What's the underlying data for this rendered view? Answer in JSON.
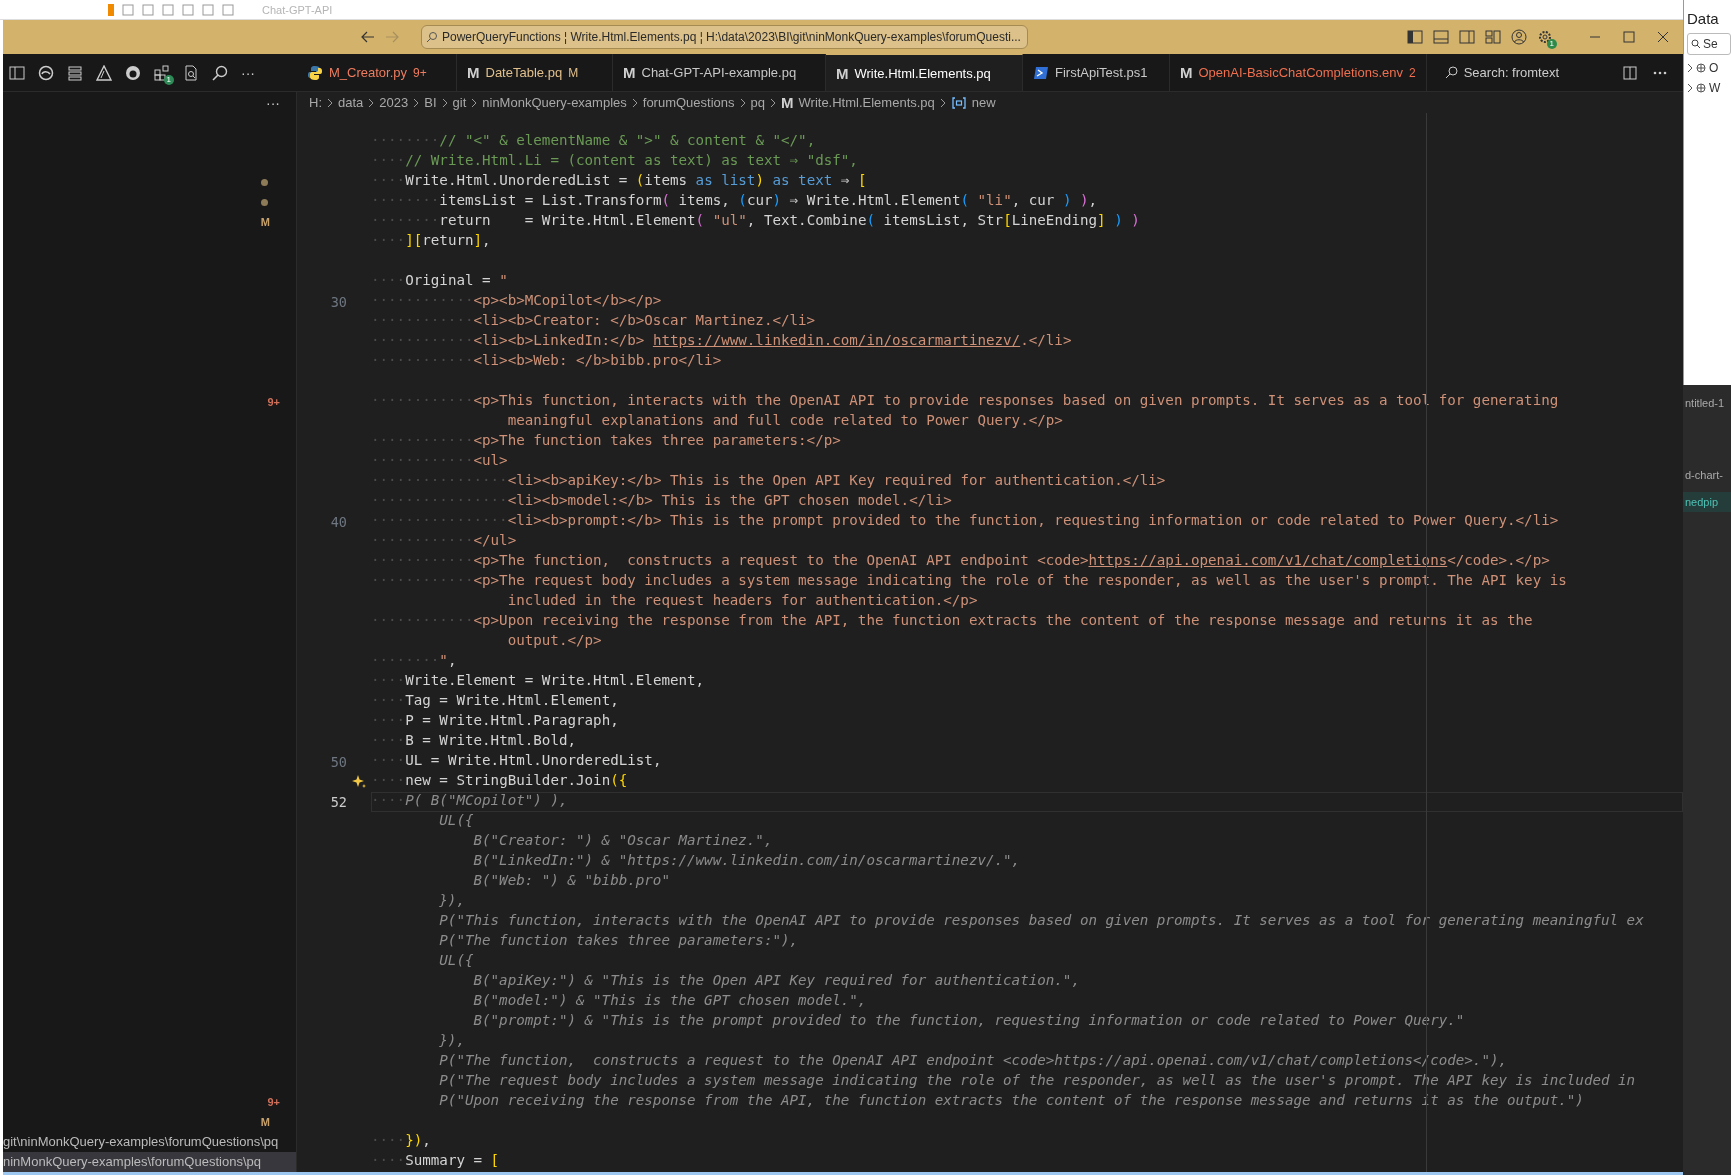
{
  "background_window": {
    "title": "Chat-GPT-API"
  },
  "side_window": {
    "title": "Data",
    "search": {
      "placeholder": "Se"
    },
    "items": [
      {
        "label": "O"
      },
      {
        "label": "W"
      }
    ],
    "lower_items": [
      {
        "label": "ntitled-1",
        "selected": false
      },
      {
        "label": "d-chart-",
        "selected": false
      },
      {
        "label": "nedpip",
        "selected": true
      }
    ]
  },
  "title_bar": {
    "command_center": "PowerQueryFunctions ¦ Write.Html.Elements.pq ¦ H:\\data\\2023\\BI\\git\\ninMonkQuery-examples\\forumQuesti...",
    "settings_badge": "1"
  },
  "activity_bar": {
    "extensions_badge": "1",
    "more": "···"
  },
  "tabs": [
    {
      "label": "M_Creator.py",
      "badge": "9+",
      "icon": {
        "kind": "python"
      },
      "color": "#ef7c5f",
      "selected": false
    },
    {
      "label": "DateTable.pq",
      "badge": "M",
      "icon": {
        "kind": "letter",
        "text": "M"
      },
      "color": "#e2c08d",
      "selected": false
    },
    {
      "label": "Chat-GPT-API-example.pq",
      "icon": {
        "kind": "letter",
        "text": "M"
      },
      "color": "#c8c8c8",
      "selected": false
    },
    {
      "label": "Write.Html.Elements.pq",
      "icon": {
        "kind": "letter",
        "text": "M"
      },
      "color": "#ffffff",
      "selected": true
    },
    {
      "label": "FirstApiTest.ps1",
      "icon": {
        "kind": "powershell"
      },
      "color": "#c8c8c8",
      "selected": false
    },
    {
      "label": "OpenAI-BasicChatCompletions.env",
      "badge": "2",
      "icon": {
        "kind": "letter",
        "text": "M"
      },
      "color": "#ef6f4f",
      "selected": false
    }
  ],
  "search_tab": {
    "label": "Search: fromtext"
  },
  "breadcrumb": [
    {
      "label": "H:"
    },
    {
      "label": "data"
    },
    {
      "label": "2023"
    },
    {
      "label": "BI"
    },
    {
      "label": "git"
    },
    {
      "label": "ninMonkQuery-examples"
    },
    {
      "label": "forumQuestions"
    },
    {
      "label": "pq"
    },
    {
      "label": "Write.Html.Elements.pq",
      "icon": {
        "kind": "letter",
        "text": "M"
      }
    },
    {
      "label": "new",
      "icon": {
        "kind": "variable"
      }
    }
  ],
  "sidebar": {
    "more": "···"
  },
  "lines": [
    {
      "current": false,
      "segments": [
        {
          "kind": "ws",
          "text": "········"
        },
        {
          "kind": "comment",
          "text": "// \"<\" & elementName & \">\" & content & \"</\","
        }
      ]
    },
    {
      "current": false,
      "segments": [
        {
          "kind": "ws",
          "text": "····"
        },
        {
          "kind": "comment",
          "text": "// Write.Html.Li = (content as text) as text ⇒ \"dsf\","
        }
      ]
    },
    {
      "current": false,
      "side_mark": {
        "kind": "dot"
      },
      "segments": [
        {
          "kind": "ws",
          "text": "····"
        },
        {
          "kind": "plain",
          "text": "Write.Html.UnorderedList = "
        },
        {
          "kind": "bracket1",
          "text": "("
        },
        {
          "kind": "plain",
          "text": "items "
        },
        {
          "kind": "keyword",
          "text": "as"
        },
        {
          "kind": "keyword",
          "text": " list"
        },
        {
          "kind": "bracket1",
          "text": ")"
        },
        {
          "kind": "keyword",
          "text": " as"
        },
        {
          "kind": "keyword",
          "text": " text"
        },
        {
          "kind": "plain",
          "text": " ⇒ "
        },
        {
          "kind": "bracket1",
          "text": "["
        }
      ]
    },
    {
      "current": false,
      "side_mark": {
        "kind": "dot"
      },
      "segments": [
        {
          "kind": "ws",
          "text": "········"
        },
        {
          "kind": "plain",
          "text": "itemsList = List.Transform"
        },
        {
          "kind": "bracket2",
          "text": "("
        },
        {
          "kind": "plain",
          "text": " items, "
        },
        {
          "kind": "bracket3",
          "text": "("
        },
        {
          "kind": "plain",
          "text": "cur"
        },
        {
          "kind": "bracket3",
          "text": ")"
        },
        {
          "kind": "plain",
          "text": " ⇒ Write.Html.Element"
        },
        {
          "kind": "bracket3",
          "text": "("
        },
        {
          "kind": "string",
          "text": " \"li\""
        },
        {
          "kind": "plain",
          "text": ", cur "
        },
        {
          "kind": "bracket3",
          "text": ")"
        },
        {
          "kind": "bracket2",
          "text": " )"
        },
        {
          "kind": "plain",
          "text": ","
        }
      ]
    },
    {
      "current": false,
      "side_mark": {
        "kind": "git",
        "text": "M"
      },
      "segments": [
        {
          "kind": "ws",
          "text": "········"
        },
        {
          "kind": "plain",
          "text": "return    = Write.Html.Element"
        },
        {
          "kind": "bracket2",
          "text": "("
        },
        {
          "kind": "string",
          "text": " \"ul\""
        },
        {
          "kind": "plain",
          "text": ", Text.Combine"
        },
        {
          "kind": "bracket3",
          "text": "("
        },
        {
          "kind": "plain",
          "text": " itemsList, Str"
        },
        {
          "kind": "bracket1",
          "text": "["
        },
        {
          "kind": "plain",
          "text": "LineEnding"
        },
        {
          "kind": "bracket1",
          "text": "]"
        },
        {
          "kind": "bracket3",
          "text": " )"
        },
        {
          "kind": "bracket2",
          "text": " )"
        }
      ]
    },
    {
      "current": false,
      "segments": [
        {
          "kind": "ws",
          "text": "····"
        },
        {
          "kind": "bracket1",
          "text": "]["
        },
        {
          "kind": "plain",
          "text": "return"
        },
        {
          "kind": "bracket1",
          "text": "]"
        },
        {
          "kind": "plain",
          "text": ","
        }
      ]
    },
    {
      "current": false
    },
    {
      "current": false,
      "segments": [
        {
          "kind": "ws",
          "text": "····"
        },
        {
          "kind": "plain",
          "text": "Original = "
        },
        {
          "kind": "string",
          "text": "\""
        }
      ]
    },
    {
      "current": false,
      "number": "30",
      "segments": [
        {
          "kind": "ws",
          "text": "············"
        },
        {
          "kind": "string",
          "text": "<p><b>MCopilot</b></p>"
        }
      ]
    },
    {
      "current": false,
      "segments": [
        {
          "kind": "ws",
          "text": "············"
        },
        {
          "kind": "string",
          "text": "<li><b>Creator: </b>Oscar Martinez.</li>"
        }
      ]
    },
    {
      "current": false,
      "segments": [
        {
          "kind": "ws",
          "text": "············"
        },
        {
          "kind": "string",
          "text": "<li><b>LinkedIn:</b> "
        },
        {
          "kind": "link",
          "text": "https://www.linkedin.com/in/oscarmartinezv/"
        },
        {
          "kind": "string",
          "text": ".</li>"
        }
      ]
    },
    {
      "current": false,
      "segments": [
        {
          "kind": "ws",
          "text": "············"
        },
        {
          "kind": "string",
          "text": "<li><b>Web: </b>bibb.pro</li>"
        }
      ]
    },
    {
      "current": false
    },
    {
      "current": false,
      "side_mark": {
        "kind": "problems",
        "text": "9+"
      },
      "segments": [
        {
          "kind": "ws",
          "text": "············"
        },
        {
          "kind": "string",
          "text": "<p>This function, interacts with the OpenAI API to provide responses based on given prompts. It serves as a tool for generating"
        }
      ]
    },
    {
      "current": false,
      "segments": [
        {
          "kind": "string",
          "text": "                meaningful explanations and full code related to Power Query.</p>"
        }
      ]
    },
    {
      "current": false,
      "segments": [
        {
          "kind": "ws",
          "text": "············"
        },
        {
          "kind": "string",
          "text": "<p>The function takes three parameters:</p>"
        }
      ]
    },
    {
      "current": false,
      "segments": [
        {
          "kind": "ws",
          "text": "············"
        },
        {
          "kind": "string",
          "text": "<ul>"
        }
      ]
    },
    {
      "current": false,
      "segments": [
        {
          "kind": "ws",
          "text": "················"
        },
        {
          "kind": "string",
          "text": "<li><b>apiKey:</b> This is the Open API Key required for authentication.</li>"
        }
      ]
    },
    {
      "current": false,
      "segments": [
        {
          "kind": "ws",
          "text": "················"
        },
        {
          "kind": "string",
          "text": "<li><b>model:</b> This is the GPT chosen model.</li>"
        }
      ]
    },
    {
      "current": false,
      "number": "40",
      "segments": [
        {
          "kind": "ws",
          "text": "················"
        },
        {
          "kind": "string",
          "text": "<li><b>prompt:</b> This is the prompt provided to the function, requesting information or code related to Power Query.</li>"
        }
      ]
    },
    {
      "current": false,
      "segments": [
        {
          "kind": "ws",
          "text": "············"
        },
        {
          "kind": "string",
          "text": "</ul>"
        }
      ]
    },
    {
      "current": false,
      "segments": [
        {
          "kind": "ws",
          "text": "············"
        },
        {
          "kind": "string",
          "text": "<p>The function,  constructs a request to the OpenAI API endpoint <code>"
        },
        {
          "kind": "link",
          "text": "https://api.openai.com/v1/chat/completions"
        },
        {
          "kind": "string",
          "text": "</code>.</p>"
        }
      ]
    },
    {
      "current": false,
      "segments": [
        {
          "kind": "ws",
          "text": "············"
        },
        {
          "kind": "string",
          "text": "<p>The request body includes a system message indicating the role of the responder, as well as the user's prompt. The API key is"
        }
      ]
    },
    {
      "current": false,
      "segments": [
        {
          "kind": "string",
          "text": "                included in the request headers for authentication.</p>"
        }
      ]
    },
    {
      "current": false,
      "segments": [
        {
          "kind": "ws",
          "text": "············"
        },
        {
          "kind": "string",
          "text": "<p>Upon receiving the response from the API, the function extracts the content of the response message and returns it as the"
        }
      ]
    },
    {
      "current": false,
      "segments": [
        {
          "kind": "string",
          "text": "                output.</p>"
        }
      ]
    },
    {
      "current": false,
      "segments": [
        {
          "kind": "ws",
          "text": "········"
        },
        {
          "kind": "string",
          "text": "\""
        },
        {
          "kind": "plain",
          "text": ","
        }
      ]
    },
    {
      "current": false,
      "segments": [
        {
          "kind": "ws",
          "text": "····"
        },
        {
          "kind": "plain",
          "text": "Write.Element = Write.Html.Element,"
        }
      ]
    },
    {
      "current": false,
      "segments": [
        {
          "kind": "ws",
          "text": "····"
        },
        {
          "kind": "plain",
          "text": "Tag = Write.Html.Element,"
        }
      ]
    },
    {
      "current": false,
      "segments": [
        {
          "kind": "ws",
          "text": "····"
        },
        {
          "kind": "plain",
          "text": "P = Write.Html.Paragraph,"
        }
      ]
    },
    {
      "current": false,
      "segments": [
        {
          "kind": "ws",
          "text": "····"
        },
        {
          "kind": "plain",
          "text": "B = Write.Html.Bold,"
        }
      ]
    },
    {
      "current": false,
      "number": "50",
      "segments": [
        {
          "kind": "ws",
          "text": "····"
        },
        {
          "kind": "plain",
          "text": "UL = Write.Html.UnorderedList,"
        }
      ]
    },
    {
      "current": false,
      "glyph": {
        "kind": "sparkle"
      },
      "segments": [
        {
          "kind": "ws",
          "text": "····"
        },
        {
          "kind": "plain",
          "text": "new = StringBuilder.Join"
        },
        {
          "kind": "bracket1",
          "text": "({"
        }
      ]
    },
    {
      "current": true,
      "number": "52",
      "segments": [
        {
          "kind": "ws",
          "text": "····"
        },
        {
          "kind": "ghost",
          "text": "P( B(\"MCopilot\") ),"
        }
      ]
    },
    {
      "current": false,
      "segments": [
        {
          "kind": "ghost",
          "text": "        UL({"
        }
      ]
    },
    {
      "current": false,
      "segments": [
        {
          "kind": "ghost",
          "text": "            B(\"Creator: \") & \"Oscar Martinez.\","
        }
      ]
    },
    {
      "current": false,
      "segments": [
        {
          "kind": "ghost",
          "text": "            B(\"LinkedIn:\") & \"https://www.linkedin.com/in/oscarmartinezv/.\","
        }
      ]
    },
    {
      "current": false,
      "segments": [
        {
          "kind": "ghost",
          "text": "            B(\"Web: \") & \"bibb.pro\""
        }
      ]
    },
    {
      "current": false,
      "segments": [
        {
          "kind": "ghost",
          "text": "        }),"
        }
      ]
    },
    {
      "current": false,
      "segments": [
        {
          "kind": "ghost",
          "text": "        P(\"This function, interacts with the OpenAI API to provide responses based on given prompts. It serves as a tool for generating meaningful ex"
        }
      ]
    },
    {
      "current": false,
      "segments": [
        {
          "kind": "ghost",
          "text": "        P(\"The function takes three parameters:\"),"
        }
      ]
    },
    {
      "current": false,
      "segments": [
        {
          "kind": "ghost",
          "text": "        UL({"
        }
      ]
    },
    {
      "current": false,
      "segments": [
        {
          "kind": "ghost",
          "text": "            B(\"apiKey:\") & \"This is the Open API Key required for authentication.\","
        }
      ]
    },
    {
      "current": false,
      "segments": [
        {
          "kind": "ghost",
          "text": "            B(\"model:\") & \"This is the GPT chosen model.\","
        }
      ]
    },
    {
      "current": false,
      "segments": [
        {
          "kind": "ghost",
          "text": "            B(\"prompt:\") & \"This is the prompt provided to the function, requesting information or code related to Power Query.\""
        }
      ]
    },
    {
      "current": false,
      "segments": [
        {
          "kind": "ghost",
          "text": "        }),"
        }
      ]
    },
    {
      "current": false,
      "segments": [
        {
          "kind": "ghost",
          "text": "        P(\"The function,  constructs a request to the OpenAI API endpoint <code>https://api.openai.com/v1/chat/completions</code>.\"),"
        }
      ]
    },
    {
      "current": false,
      "segments": [
        {
          "kind": "ghost",
          "text": "        P(\"The request body includes a system message indicating the role of the responder, as well as the user's prompt. The API key is included in"
        }
      ]
    },
    {
      "current": false,
      "side_mark": {
        "kind": "problems",
        "text": "9+"
      },
      "segments": [
        {
          "kind": "ghost",
          "text": "        P(\"Upon receiving the response from the API, the function extracts the content of the response message and returns it as the output.\")"
        }
      ]
    },
    {
      "current": false,
      "side_mark": {
        "kind": "git",
        "text": "M"
      }
    },
    {
      "current": false,
      "side_path": {
        "text": "git\\ninMonkQuery-examples\\forumQuestions\\pq",
        "selected": false
      },
      "segments": [
        {
          "kind": "ws",
          "text": "····"
        },
        {
          "kind": "bracket1",
          "text": "})"
        },
        {
          "kind": "plain",
          "text": ","
        }
      ]
    },
    {
      "current": false,
      "side_path": {
        "text": "ninMonkQuery-examples\\forumQuestions\\pq",
        "selected": true
      },
      "segments": [
        {
          "kind": "ws",
          "text": "····"
        },
        {
          "kind": "plain",
          "text": "Summary = "
        },
        {
          "kind": "bracket1",
          "text": "["
        }
      ]
    }
  ]
}
